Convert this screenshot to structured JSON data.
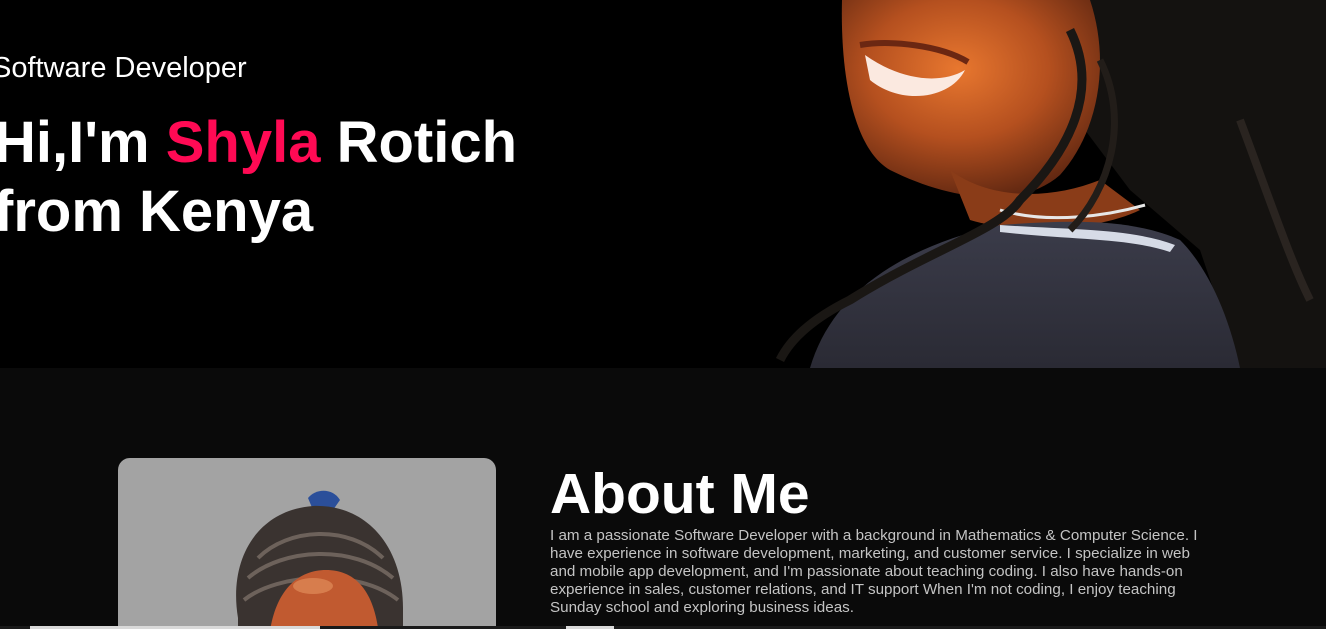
{
  "hero": {
    "subtitle": "Software Developer",
    "title_prefix": "Hi,I'm ",
    "title_name": "Shyla",
    "title_suffix": " Rotich from Kenya",
    "accent_color": "#ff0a54"
  },
  "about": {
    "heading": "About Me",
    "text": "I am a passionate Software Developer with a background in Mathematics & Computer Science. I have experience in software development, marketing, and customer service. I specialize in web and mobile app development, and I'm passionate about teaching coding. I also have hands-on experience in sales, customer relations, and IT support When I'm not coding, I enjoy teaching Sunday school and exploring business ideas."
  }
}
